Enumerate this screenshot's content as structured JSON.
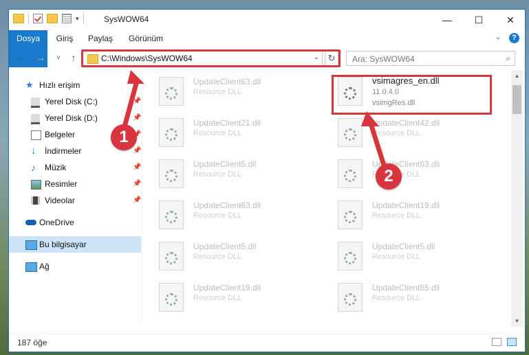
{
  "window": {
    "title": "SysWOW64",
    "controls": {
      "minimize": "—",
      "maximize": "☐",
      "close": "✕"
    }
  },
  "ribbon": {
    "tabs": [
      "Dosya",
      "Giriş",
      "Paylaş",
      "Görünüm"
    ],
    "expand_icon": "chevron-down-icon",
    "help_label": "?"
  },
  "nav": {
    "back": "←",
    "forward": "→",
    "recent": "˅",
    "up": "↑",
    "address": "C:\\Windows\\SysWOW64",
    "refresh": "↻",
    "search_placeholder": "Ara: SysWOW64"
  },
  "sidebar": {
    "items": [
      {
        "label": "Hızlı erişim",
        "icon": "star-icon",
        "pinned": false
      },
      {
        "label": "Yerel Disk (C:)",
        "icon": "drive-icon",
        "pinned": true
      },
      {
        "label": "Yerel Disk (D:)",
        "icon": "drive-icon",
        "pinned": true
      },
      {
        "label": "Belgeler",
        "icon": "documents-icon",
        "pinned": true
      },
      {
        "label": "İndirmeler",
        "icon": "download-icon",
        "pinned": true
      },
      {
        "label": "Müzik",
        "icon": "music-icon",
        "pinned": true
      },
      {
        "label": "Resimler",
        "icon": "pictures-icon",
        "pinned": true
      },
      {
        "label": "Videolar",
        "icon": "video-icon",
        "pinned": true
      },
      {
        "label": "OneDrive",
        "icon": "cloud-icon",
        "pinned": false
      },
      {
        "label": "Bu bilgisayar",
        "icon": "computer-icon",
        "pinned": false,
        "selected": true
      },
      {
        "label": "Ağ",
        "icon": "network-icon",
        "pinned": false
      }
    ]
  },
  "files": {
    "highlighted": {
      "name": "vsimagres_en.dll",
      "version": "11.0.4.0",
      "description": "vsimgRes.dll"
    },
    "left_column": [
      {
        "name": "UpdateClient63.dll",
        "type": "Resource DLL"
      },
      {
        "name": "UpdateClient21.dll",
        "type": "Resource DLL"
      },
      {
        "name": "UpdateClient5.dll",
        "type": "Resource DLL"
      },
      {
        "name": "UpdateClient63.dll",
        "type": "Resource DLL"
      },
      {
        "name": "UpdateClient5.dll",
        "type": "Resource DLL"
      },
      {
        "name": "UpdateClient19.dll",
        "type": "Resource DLL"
      }
    ],
    "right_column": [
      {
        "name": "UpdateClient42.dll",
        "type": "Resource DLL"
      },
      {
        "name": "UpdateClient63.dll",
        "type": "Resource DLL"
      },
      {
        "name": "UpdateClient19.dll",
        "type": "Resource DLL"
      },
      {
        "name": "UpdateClient5.dll",
        "type": "Resource DLL"
      },
      {
        "name": "UpdateClient65.dll",
        "type": "Resource DLL"
      }
    ]
  },
  "status": {
    "item_count": "187 öğe"
  },
  "annotations": {
    "badge1": "1",
    "badge2": "2",
    "color": "#d9353f"
  }
}
